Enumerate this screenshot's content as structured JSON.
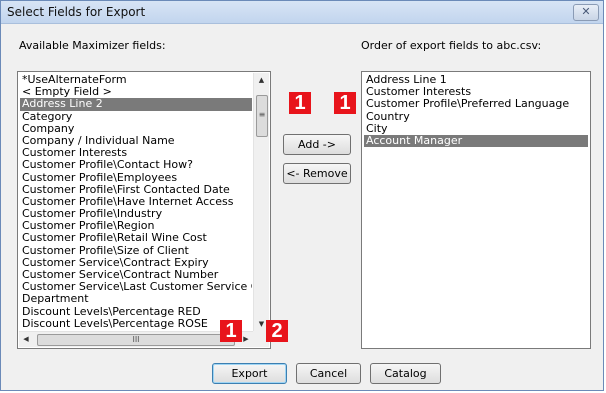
{
  "window": {
    "title": "Select Fields for Export",
    "close_symbol": "✕"
  },
  "available": {
    "label": "Available Maximizer fields:",
    "items": [
      "*UseAlternateForm",
      "< Empty Field >",
      "Address Line 2",
      "Category",
      "Company",
      "Company / Individual Name",
      "Customer Interests",
      "Customer Profile\\Contact How?",
      "Customer Profile\\Employees",
      "Customer Profile\\First Contacted Date",
      "Customer Profile\\Have Internet Access",
      "Customer Profile\\Industry",
      "Customer Profile\\Region",
      "Customer Profile\\Retail Wine Cost",
      "Customer Profile\\Size of Client",
      "Customer Service\\Contract Expiry",
      "Customer Service\\Contract Number",
      "Customer Service\\Last Customer Service Call",
      "Department",
      "Discount Levels\\Percentage RED",
      "Discount Levels\\Percentage ROSE"
    ],
    "selected_item": "Address Line 2"
  },
  "order": {
    "label": "Order of export fields to abc.csv:",
    "items": [
      "Address Line 1",
      "Customer Interests",
      "Customer Profile\\Preferred Language",
      "Country",
      "City",
      "Account Manager"
    ],
    "selected_item": "Account Manager"
  },
  "buttons": {
    "add": "Add ->",
    "remove": "<- Remove",
    "export": "Export",
    "cancel": "Cancel",
    "catalog": "Catalog"
  },
  "scrollbar": {
    "up_arrow": "▲",
    "down_arrow": "▼",
    "left_arrow": "◀",
    "right_arrow": "▶",
    "v_grip": "≡",
    "h_grip": "III"
  },
  "callouts": {
    "top_left": "1",
    "top_right": "1",
    "bottom_left": "1",
    "bottom_right": "2",
    "color": "#e8141b"
  }
}
